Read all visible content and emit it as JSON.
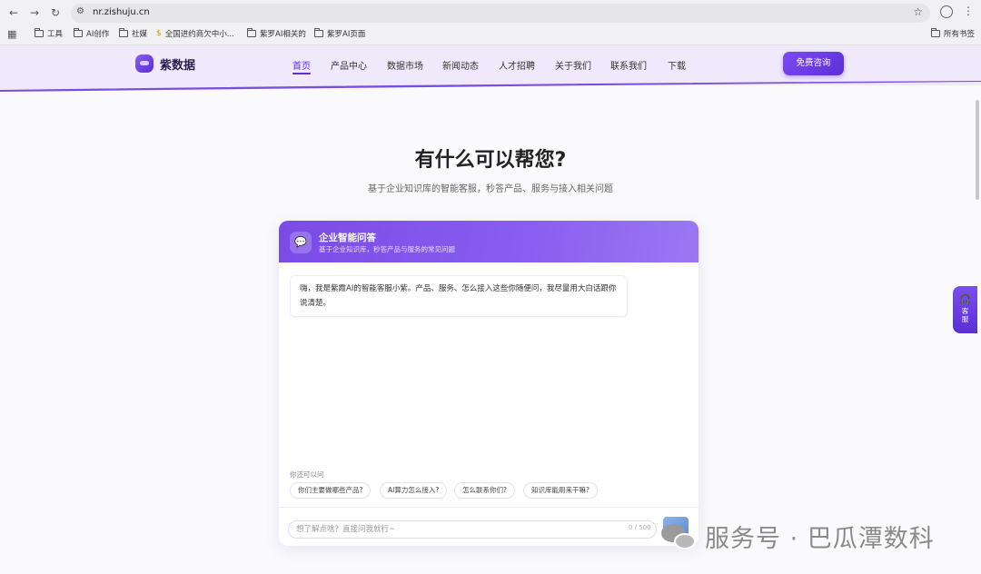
{
  "browser": {
    "url": "nr.zishuju.cn",
    "bookmarks": [
      "工具",
      "AI创作",
      "社媒",
      "全国进约商欠中小...",
      "紫罗AI相关的",
      "紫罗AI页面"
    ],
    "all_bookmarks": "所有书签"
  },
  "site": {
    "logo": "紫数据",
    "nav": [
      "首页",
      "产品中心",
      "数据市场",
      "新闻动态",
      "人才招聘",
      "关于我们",
      "联系我们",
      "下载"
    ],
    "active_nav": "首页",
    "cta": "免费咨询",
    "accent": "#5b2fd4"
  },
  "hero": {
    "title": "有什么可以帮您?",
    "subtitle": "基于企业知识库的智能客服，秒答产品、服务与接入相关问题"
  },
  "chat": {
    "title": "企业智能问答",
    "subtitle": "基于企业知识库，秒答产品与服务的常见问题",
    "welcome": "嗨，我是紫霞AI的智能客服小紫。产品、服务、怎么接入这些你随便问，我尽量用大白话跟你说清楚。",
    "suggest_label": "你还可以问",
    "suggestions": [
      "你们主要做哪些产品?",
      "AI算力怎么接入?",
      "怎么联系你们?",
      "知识库能用来干嘛?"
    ],
    "input_placeholder": "想了解点啥？直接问我就行~",
    "char_count": "0 / 500"
  },
  "service_tab": "客服",
  "watermark": "服务号 · 巴瓜潭数科"
}
